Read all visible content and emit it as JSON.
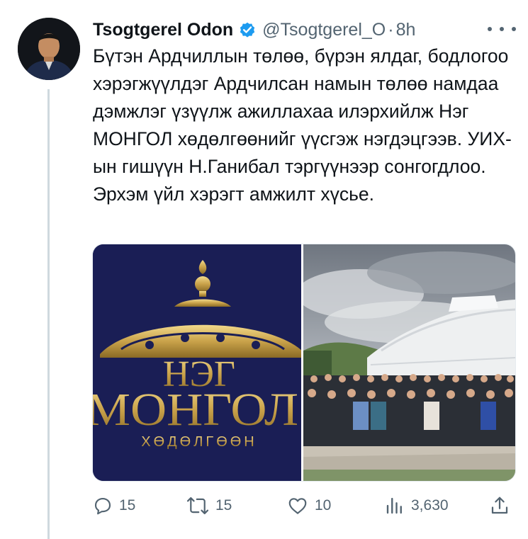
{
  "tweet": {
    "author_name": "Tsogtgerel Odon",
    "author_handle": "@Tsogtgerel_O",
    "separator": "·",
    "time": "8h",
    "text": "Бүтэн Ардчиллын төлөө, бүрэн ялдаг, бодлогоо хэрэгжүүлдэг Ардчилсан намын төлөө намдаа дэмжлэг үзүүлж ажиллахаа илэрхийлж Нэг МОНГОЛ хөдөлгөөнийг үүсгэж нэгдэцгээв. УИХ-ын гишүүн Н.Ганибал тэргүүнээр сонгогдлоо. Эрхэм үйл хэрэгт амжилт хүсье."
  },
  "media": {
    "logo": {
      "line1": "НЭГ",
      "line2": "МОНГОЛ",
      "line3": "ХӨДӨЛГӨӨН",
      "background": "#1a1e55",
      "gold": "#c9a24a"
    },
    "photo_icon": "group-photo-yurt"
  },
  "actions": {
    "replies": "15",
    "retweets": "15",
    "likes": "10",
    "views": "3,630"
  },
  "icons": {
    "verified": "verified-badge-icon",
    "reply": "reply-icon",
    "retweet": "retweet-icon",
    "like": "heart-icon",
    "views": "views-chart-icon",
    "share": "share-icon",
    "more": "more-dots-icon"
  },
  "colors": {
    "verified": "#1d9bf0",
    "secondary_text": "#536471"
  }
}
